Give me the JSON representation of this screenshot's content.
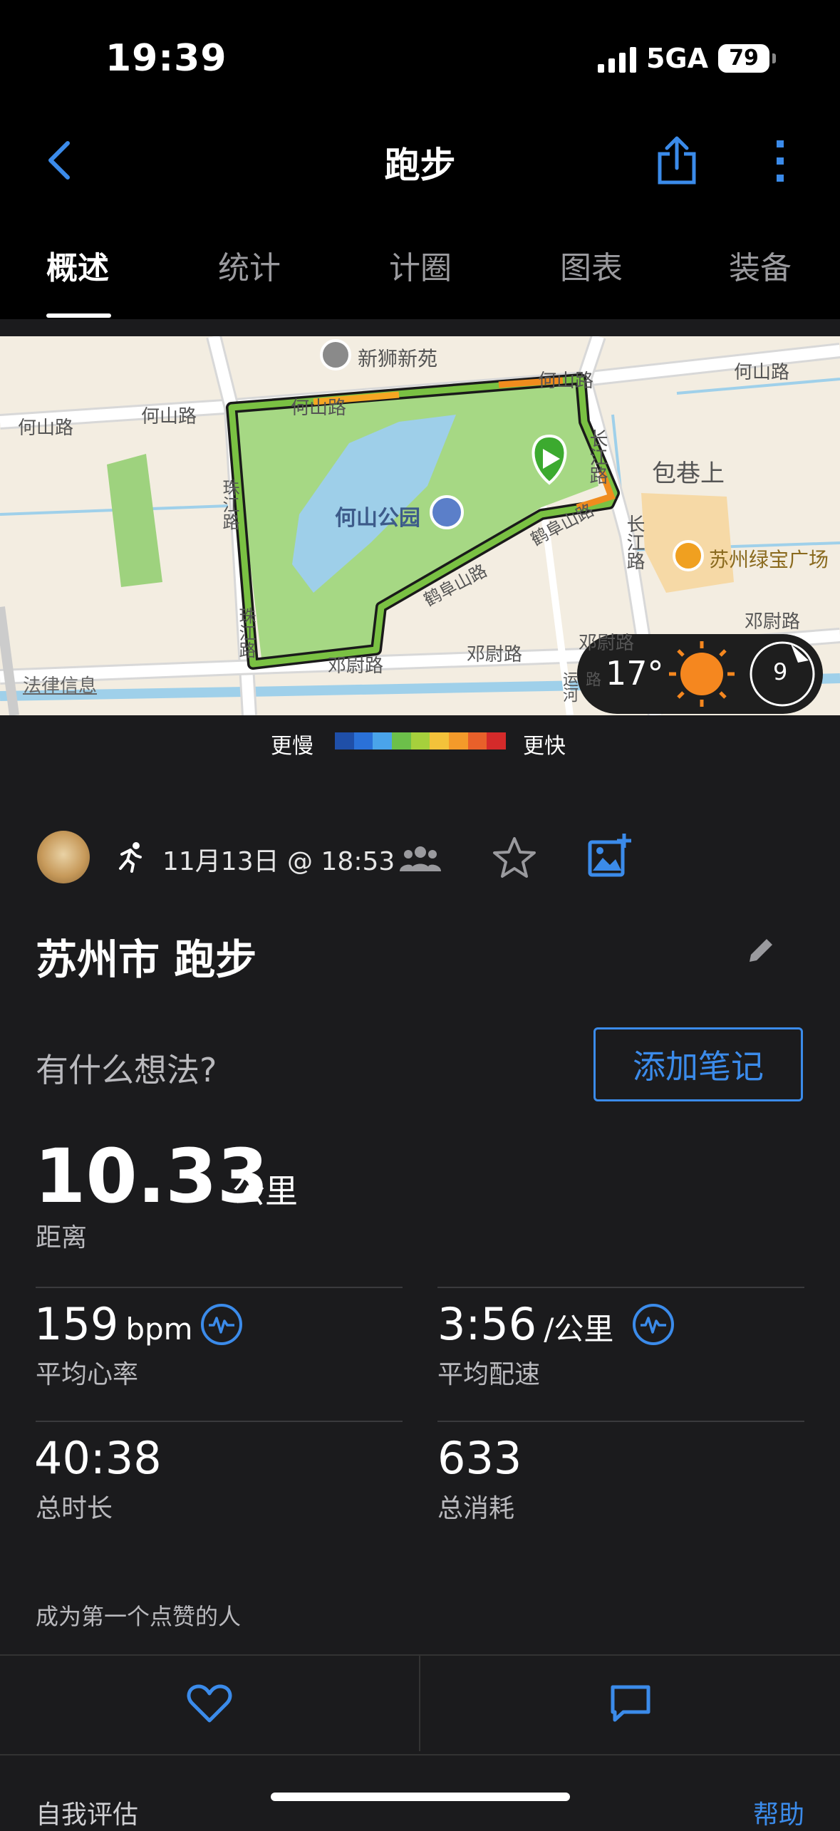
{
  "status_bar": {
    "time": "19:39",
    "network": "5GA",
    "battery": "79"
  },
  "nav": {
    "title": "跑步",
    "back_icon": "chevron-left-icon",
    "share_icon": "share-icon",
    "more_icon": "more-vertical-icon"
  },
  "tabs": [
    {
      "label": "概述",
      "active": true
    },
    {
      "label": "统计",
      "active": false
    },
    {
      "label": "计圈",
      "active": false
    },
    {
      "label": "图表",
      "active": false
    },
    {
      "label": "装备",
      "active": false
    }
  ],
  "map": {
    "labels": {
      "xinshi": "新狮新苑",
      "heshanlu_1": "何山路",
      "heshanlu_2": "何山路",
      "heshanlu_3": "何山路",
      "heshanlu_4": "何山路",
      "heshanlu_5": "何山路",
      "heshan_park": "何山公园",
      "changjiang_1": "长江路",
      "changjiang_2": "长江路",
      "baoxiang": "包巷上",
      "suzhou_plaza": "苏州绿宝广场",
      "hefu_1": "鹤阜山路",
      "hefu_2": "鹤阜山路",
      "zhujiang_1": "珠江路",
      "zhujiang_2": "珠江路",
      "dengwei_1": "邓尉路",
      "dengwei_2": "邓尉路",
      "dengwei_3": "邓尉路",
      "dengwei_4": "邓尉路",
      "yuanqiao": "运河路",
      "legal": "法律信息"
    },
    "weather": {
      "temp": "17°",
      "wind": "9",
      "icon": "sun-icon"
    }
  },
  "legend": {
    "slow": "更慢",
    "fast": "更快",
    "colors": [
      "#1f4fa8",
      "#2a71d8",
      "#4aa4ea",
      "#6cc04a",
      "#a6d03c",
      "#f3c23a",
      "#f39a2a",
      "#e8602a",
      "#d42a2a"
    ]
  },
  "activity": {
    "date": "11月13日 @ 18:53",
    "title": "苏州市 跑步",
    "prompt": "有什么想法?",
    "add_note": "添加笔记",
    "distance": {
      "value": "10.33",
      "unit": "公里",
      "label": "距离"
    },
    "stats": [
      {
        "value": "159",
        "unit": "bpm",
        "label": "平均心率"
      },
      {
        "value": "3:56",
        "unit": "/公里",
        "label": "平均配速"
      },
      {
        "value": "40:38",
        "unit": "",
        "label": "总时长"
      },
      {
        "value": "633",
        "unit": "",
        "label": "总消耗"
      }
    ],
    "kudos": "成为第一个点赞的人"
  },
  "bottom": {
    "self_eval": "自我评估",
    "help": "帮助"
  }
}
